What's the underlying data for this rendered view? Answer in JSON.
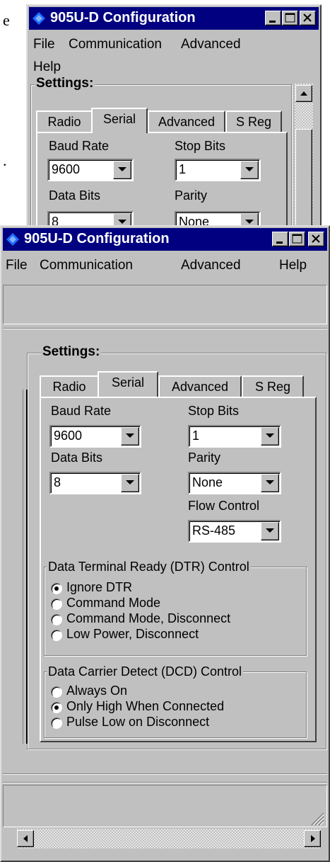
{
  "doc_fragments": [
    "e",
    "."
  ],
  "back_window": {
    "title": "905U-D Configuration",
    "menu": [
      "File",
      "Communication",
      "Advanced",
      "Help"
    ],
    "settings_label": "Settings:",
    "tabs": [
      "Radio",
      "Serial",
      "Advanced",
      "S Reg"
    ],
    "active_tab": "Serial",
    "fields": {
      "baud_rate": {
        "label": "Baud Rate",
        "value": "9600"
      },
      "stop_bits": {
        "label": "Stop Bits",
        "value": "1"
      },
      "data_bits": {
        "label": "Data Bits",
        "value": "8"
      },
      "parity": {
        "label": "Parity",
        "value": "None"
      }
    }
  },
  "front_window": {
    "title": "905U-D Configuration",
    "menu": [
      "File",
      "Communication",
      "Advanced",
      "Help"
    ],
    "settings_label": "Settings:",
    "tabs": [
      "Radio",
      "Serial",
      "Advanced",
      "S Reg"
    ],
    "active_tab": "Serial",
    "fields": {
      "baud_rate": {
        "label": "Baud Rate",
        "value": "9600"
      },
      "stop_bits": {
        "label": "Stop Bits",
        "value": "1"
      },
      "data_bits": {
        "label": "Data Bits",
        "value": "8"
      },
      "parity": {
        "label": "Parity",
        "value": "None"
      },
      "flow_control": {
        "label": "Flow Control",
        "value": "RS-485"
      }
    },
    "dtr_group": {
      "label": "Data Terminal Ready (DTR) Control",
      "options": [
        "Ignore DTR",
        "Command Mode",
        "Command Mode, Disconnect",
        "Low Power, Disconnect"
      ],
      "selected": "Ignore DTR"
    },
    "dcd_group": {
      "label": "Data Carrier Detect (DCD) Control",
      "options": [
        "Always On",
        "Only High When Connected",
        "Pulse Low on Disconnect"
      ],
      "selected": "Only High When Connected"
    }
  },
  "icons": {
    "app": "diamond-app-icon",
    "minimize": "minimize-icon",
    "maximize": "maximize-icon",
    "close": "close-icon",
    "dropdown": "chevron-down-icon",
    "scroll_up": "arrow-up-icon",
    "scroll_left": "arrow-left-icon",
    "scroll_right": "arrow-right-icon",
    "size_grip": "size-grip-icon"
  },
  "colors": {
    "titlebar": "#000080",
    "face": "#c0c0c0"
  }
}
